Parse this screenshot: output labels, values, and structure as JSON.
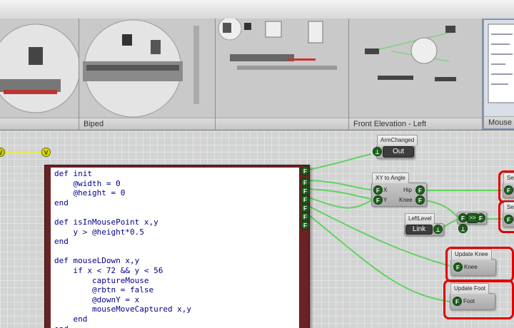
{
  "thumbnails": [
    {
      "label": ""
    },
    {
      "label": "Biped"
    },
    {
      "label": ""
    },
    {
      "label": "Front Elevation - Left"
    },
    {
      "label": "Mouse In"
    }
  ],
  "code_node": {
    "pin_top": "V",
    "lines": [
      "def init",
      "    @width = 0",
      "    @height = 0",
      "end",
      "",
      "def isInMousePoint x,y",
      "    y > @height*0.5",
      "end",
      "",
      "def mouseLDown x,y",
      "    if x < 72 && y < 56",
      "        captureMouse",
      "        @rbtn = false",
      "        @downY = x",
      "        mouseMoveCaptured x,y",
      "    end",
      "end"
    ],
    "output_pins": [
      "F",
      "F",
      "F",
      "F",
      "F",
      "F",
      "F"
    ]
  },
  "nodes": {
    "arm_changed": {
      "title": "ArmChanged",
      "label": "Out"
    },
    "xy_to_angle": {
      "title": "XY to Angle",
      "in_x": "X",
      "in_y": "Y",
      "out_hip": "Hip",
      "out_knee": "Knee"
    },
    "left_level": {
      "title": "LeftLevel",
      "label": "Link"
    },
    "merge": {
      "label": ">>"
    },
    "update_knee": {
      "title": "Update Knee",
      "label": "Knee"
    },
    "update_foot": {
      "title": "Update Foot",
      "label": "Foot"
    },
    "set_hip": {
      "title": "Se",
      "label": "Hi"
    },
    "set_knee": {
      "title": "Se",
      "label": "K"
    }
  },
  "colors": {
    "wire": "#5fd35f",
    "highlight": "#e00000",
    "code_border": "#6b2225",
    "pin": "#1f5e1f"
  }
}
